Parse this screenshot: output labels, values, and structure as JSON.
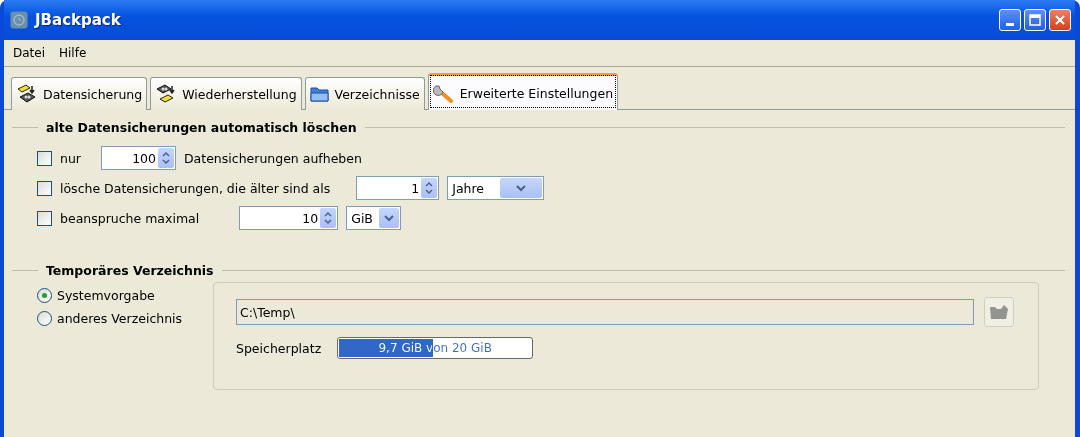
{
  "window": {
    "title": "JBackpack"
  },
  "menu": [
    "Datei",
    "Hilfe"
  ],
  "tabs": [
    {
      "label": "Datensicherung",
      "selected": false
    },
    {
      "label": "Wiederherstellung",
      "selected": false
    },
    {
      "label": "Verzeichnisse",
      "selected": false
    },
    {
      "label": "Erweiterte Einstellungen",
      "selected": true
    }
  ],
  "auto_delete": {
    "title": "alte Datensicherungen automatisch löschen",
    "rows": [
      {
        "label": "nur",
        "checked": false,
        "value": "100",
        "suffix": "Datensicherungen aufheben"
      },
      {
        "label": "lösche Datensicherungen, die älter sind als",
        "checked": false,
        "value": "1",
        "unit": "Jahre"
      },
      {
        "label": "beanspruche maximal",
        "checked": false,
        "value": "10",
        "unit": "GiB"
      }
    ]
  },
  "temp_dir": {
    "title": "Temporäres Verzeichnis",
    "options": [
      {
        "label": "Systemvorgabe",
        "selected": true
      },
      {
        "label": "anderes Verzeichnis",
        "selected": false
      }
    ],
    "path": "C:\\Temp\\",
    "browse_disabled": true,
    "space_label": "Speicherplatz",
    "space": {
      "level": 0.485,
      "reading": "9,7 GiB von 20 GiB"
    }
  }
}
